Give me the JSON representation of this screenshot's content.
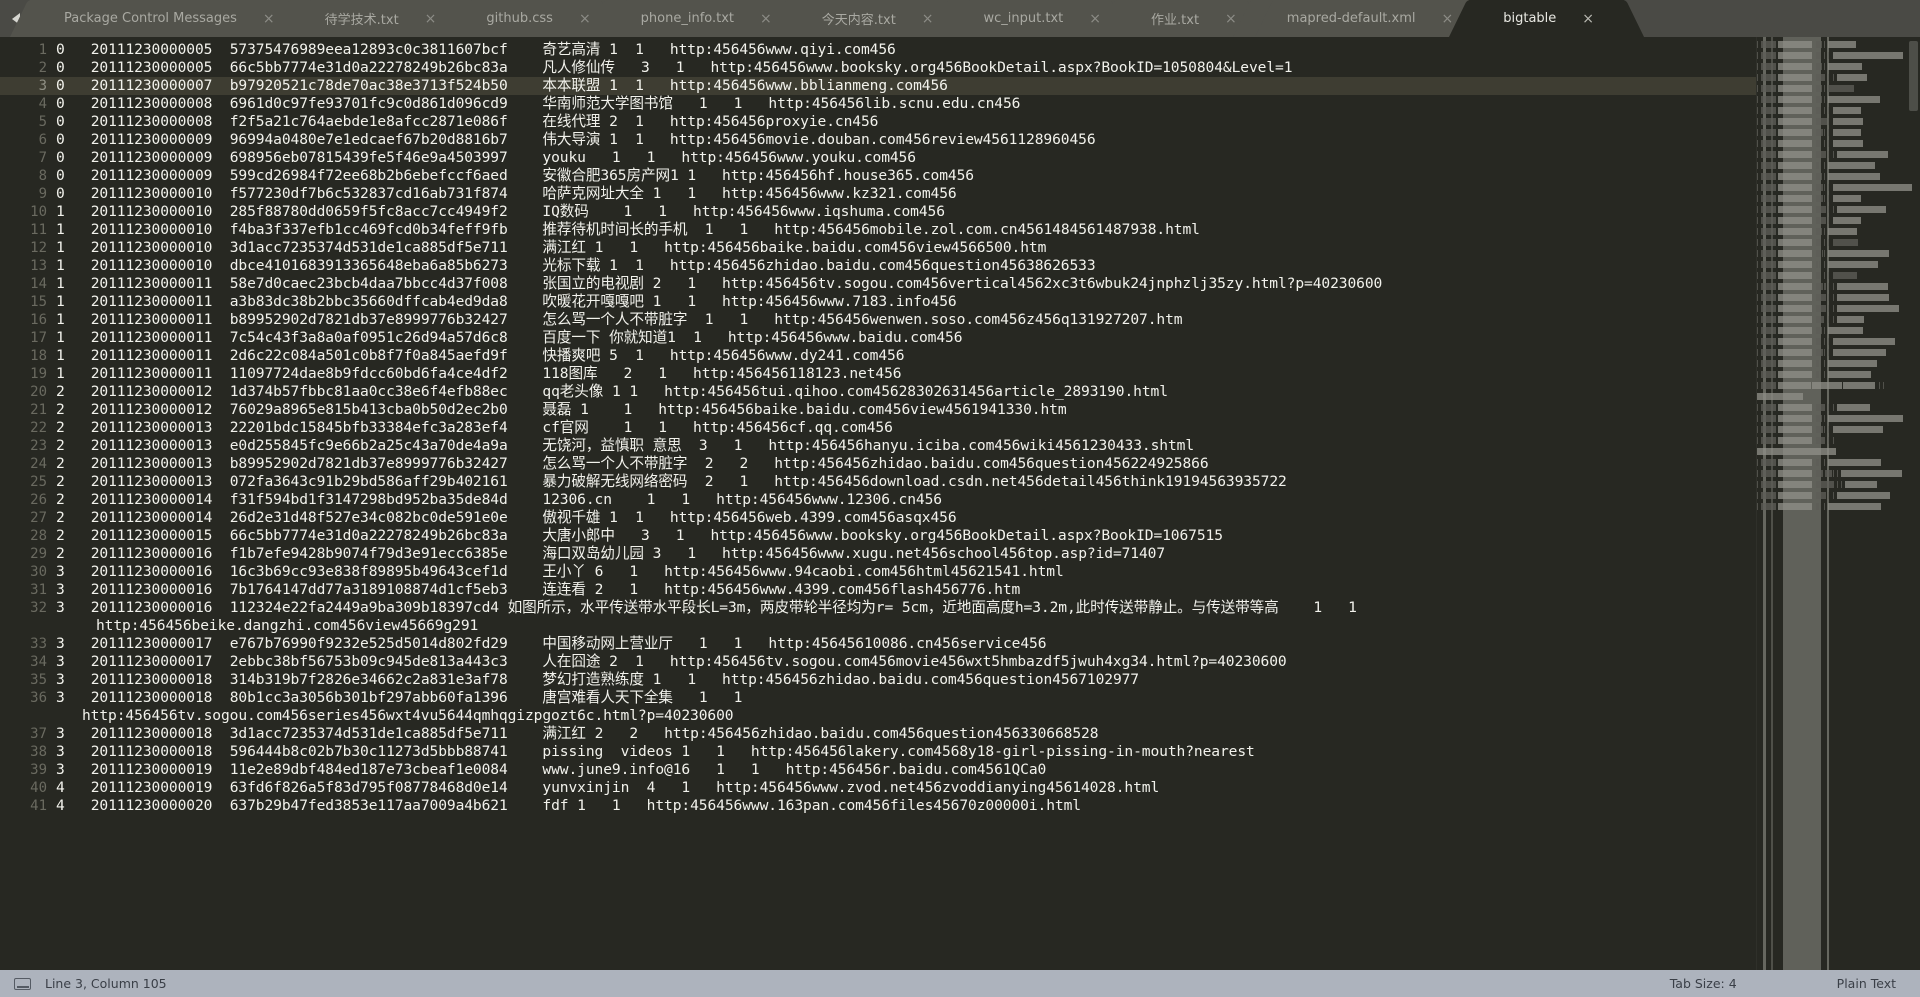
{
  "window": {
    "app": "Sublime Text",
    "nav_prev_icon": "triangle-left-icon",
    "nav_next_icon": "triangle-right-icon",
    "close_glyph": "×"
  },
  "tabs": [
    {
      "label": "Package Control Messages",
      "active": false
    },
    {
      "label": "待学技术.txt",
      "active": false
    },
    {
      "label": "github.css",
      "active": false
    },
    {
      "label": "phone_info.txt",
      "active": false
    },
    {
      "label": "今天内容.txt",
      "active": false
    },
    {
      "label": "wc_input.txt",
      "active": false
    },
    {
      "label": "作业.txt",
      "active": false
    },
    {
      "label": "mapred-default.xml",
      "active": false
    },
    {
      "label": "bigtable",
      "active": true
    }
  ],
  "editor": {
    "active_line_number": 3,
    "lines": [
      {
        "n": "1",
        "text": "0\t20111230000005\t57375476989eea12893c0c3811607bcf\t奇艺高清 1\t1\thttp:456456www.qiyi.com456"
      },
      {
        "n": "2",
        "text": "0\t20111230000005\t66c5bb7774e31d0a22278249b26bc83a\t凡人修仙传\t3\t1\thttp:456456www.booksky.org456BookDetail.aspx?BookID=1050804&Level=1"
      },
      {
        "n": "3",
        "text": "0\t20111230000007\tb97920521c78de70ac38e3713f524b50\t本本联盟 1\t1\thttp:456456www.bblianmeng.com456"
      },
      {
        "n": "4",
        "text": "0\t20111230000008\t6961d0c97fe93701fc9c0d861d096cd9\t华南师范大学图书馆\t1\t1\thttp:456456lib.scnu.edu.cn456"
      },
      {
        "n": "5",
        "text": "0\t20111230000008\tf2f5a21c764aebde1e8afcc2871e086f\t在线代理 2\t1\thttp:456456proxyie.cn456"
      },
      {
        "n": "6",
        "text": "0\t20111230000009\t96994a0480e7e1edcaef67b20d8816b7\t伟大导演 1\t1\thttp:456456movie.douban.com456review4561128960456"
      },
      {
        "n": "7",
        "text": "0\t20111230000009\t698956eb07815439fe5f46e9a4503997\tyouku\t1\t1\thttp:456456www.youku.com456"
      },
      {
        "n": "8",
        "text": "0\t20111230000009\t599cd26984f72ee68b2b6ebefccf6aed\t安徽合肥365房产网1\t1\thttp:456456hf.house365.com456"
      },
      {
        "n": "9",
        "text": "0\t20111230000010\tf577230df7b6c532837cd16ab731f874\t哈萨克网址大全\t1\t1\thttp:456456www.kz321.com456"
      },
      {
        "n": "10",
        "text": "1\t20111230000010\t285f88780dd0659f5fc8acc7cc4949f2\tIQ数码\t1\t1\thttp:456456www.iqshuma.com456"
      },
      {
        "n": "11",
        "text": "1\t20111230000010\tf4ba3f337efb1cc469fcd0b34feff9fb\t推荐待机时间长的手机\t1\t1\thttp:456456mobile.zol.com.cn4561484561487938.html"
      },
      {
        "n": "12",
        "text": "1\t20111230000010\t3d1acc7235374d531de1ca885df5e711\t满江红\t1\t1\thttp:456456baike.baidu.com456view4566500.htm"
      },
      {
        "n": "13",
        "text": "1\t20111230000010\tdbce4101683913365648eba6a85b6273\t光标下载 1\t1\thttp:456456zhidao.baidu.com456question45638626533"
      },
      {
        "n": "14",
        "text": "1\t20111230000011\t58e7d0caec23bcb4daa7bbcc4d37f008\t张国立的电视剧\t2\t1\thttp:456456tv.sogou.com456vertical4562xc3t6wbuk24jnphzlj35zy.html?p=40230600"
      },
      {
        "n": "15",
        "text": "1\t20111230000011\ta3b83dc38b2bbc35660dffcab4ed9da8\t吹暖花开嘎嘎吧\t1\t1\thttp:456456www.7183.info456"
      },
      {
        "n": "16",
        "text": "1\t20111230000011\tb89952902d7821db37e8999776b32427\t怎么骂一个人不带脏字\t1\t1\thttp:456456wenwen.soso.com456z456q131927207.htm"
      },
      {
        "n": "17",
        "text": "1\t20111230000011\t7c54c43f3a8a0af0951c26d94a57d6c8\t百度一下 你就知道1\t1\thttp:456456www.baidu.com456"
      },
      {
        "n": "18",
        "text": "1\t20111230000011\t2d6c22c084a501c0b8f7f0a845aefd9f\t快播爽吧 5\t1\thttp:456456www.dy241.com456"
      },
      {
        "n": "19",
        "text": "1\t20111230000011\t11097724dae8b9fdcc60bd6fa4ce4df2\t118图库\t2\t1\thttp:456456118123.net456"
      },
      {
        "n": "20",
        "text": "2\t20111230000012\t1d374b57fbbc81aa0cc38e6f4efb88ec\tqq老头像 1\t1\thttp:456456tui.qihoo.com45628302631456article_2893190.html"
      },
      {
        "n": "21",
        "text": "2\t20111230000012\t76029a8965e815b413cba0b50d2ec2b0\t聂磊 1\t1\thttp:456456baike.baidu.com456view4561941330.htm"
      },
      {
        "n": "22",
        "text": "2\t20111230000013\t22201bdc15845bfb33384efc3a283ef4\tcf官网\t1\t1\thttp:456456cf.qq.com456"
      },
      {
        "n": "23",
        "text": "2\t20111230000013\te0d255845fc9e66b2a25c43a70de4a9a\t无饶河，益慎职 意思\t3\t1\thttp:456456hanyu.iciba.com456wiki4561230433.shtml"
      },
      {
        "n": "24",
        "text": "2\t20111230000013\tb89952902d7821db37e8999776b32427\t怎么骂一个人不带脏字\t2\t2\thttp:456456zhidao.baidu.com456question456224925866"
      },
      {
        "n": "25",
        "text": "2\t20111230000013\t072fa3643c91b29bd586aff29b402161\t暴力破解无线网络密码\t2\t1\thttp:456456download.csdn.net456detail456think19194563935722"
      },
      {
        "n": "26",
        "text": "2\t20111230000014\tf31f594bd1f3147298bd952ba35de84d\t12306.cn\t1\t1\thttp:456456www.12306.cn456"
      },
      {
        "n": "27",
        "text": "2\t20111230000014\t26d2e31d48f527e34c082bc0de591e0e\t傲视千雄 1\t1\thttp:456456web.4399.com456asqx456"
      },
      {
        "n": "28",
        "text": "2\t20111230000015\t66c5bb7774e31d0a22278249b26bc83a\t大唐小郎中\t3\t1\thttp:456456www.booksky.org456BookDetail.aspx?BookID=1067515"
      },
      {
        "n": "29",
        "text": "2\t20111230000016\tf1b7efe9428b9074f79d3e91ecc6385e\t海口双岛幼儿园\t3\t1\thttp:456456www.xugu.net456school456top.asp?id=71407"
      },
      {
        "n": "30",
        "text": "3\t20111230000016\t16c3b69cc93e838f89895b49643cef1d\t王小丫\t6\t1\thttp:456456www.94caobi.com456html45621541.html"
      },
      {
        "n": "31",
        "text": "3\t20111230000016\t7b1764147dd77a3189108874d1cf5eb3\t连连看\t2\t1\thttp:456456www.4399.com456flash456776.htm"
      },
      {
        "n": "32",
        "text": "3\t20111230000016\t112324e22fa2449a9ba309b18397cd4\t如图所示，水平传送带水平段长L=3m，两皮带轮半径均为r= 5cm，近地面高度h=3.2m,此时传送带静止。与传送带等高\t1\t1"
      },
      {
        "n": "",
        "text": "http:456456beike.dangzhi.com456view45669g291",
        "wrap": true
      },
      {
        "n": "33",
        "text": "3\t20111230000017\te767b76990f9232e525d5014d802fd29\t中国移动网上营业厅\t1\t1\thttp:45645610086.cn456service456"
      },
      {
        "n": "34",
        "text": "3\t20111230000017\t2ebbc38bf56753b09c945de813a443c3\t人在囧途 2\t1\thttp:456456tv.sogou.com456movie456wxt5hmbazdf5jwuh4xg34.html?p=40230600"
      },
      {
        "n": "35",
        "text": "3\t20111230000018\t314b319b7f2826e34662c2a831e3af78\t梦幻打造熟练度\t1\t1\thttp:456456zhidao.baidu.com456question4567102977"
      },
      {
        "n": "36",
        "text": "3\t20111230000018\t80b1cc3a3056b301bf297abb60fa1396\t唐宫难看人天下全集\t1\t1"
      },
      {
        "n": "",
        "text": "http:456456tv.sogou.com456series456wxt4vu5644qmhqgizpgozt6c.html?p=40230600",
        "wrap": true,
        "narrow": true
      },
      {
        "n": "37",
        "text": "3\t20111230000018\t3d1acc7235374d531de1ca885df5e711\t满江红\t2\t2\thttp:456456zhidao.baidu.com456question456330668528"
      },
      {
        "n": "38",
        "text": "3\t20111230000018\t596444b8c02b7b30c11273d5bbb88741\tpissing  videos 1\t1\thttp:456456lakery.com4568y18-girl-pissing-in-mouth?nearest"
      },
      {
        "n": "39",
        "text": "3\t20111230000019\t11e2e89dbf484ed187e73cbeaf1e0084\twww.june9.info@16\t1\t1\thttp:456456r.baidu.com4561QCa0"
      },
      {
        "n": "40",
        "text": "4\t20111230000019\t63fd6f826a5f83d795f08778468d0e14\tyunvxinjin\t4\t1\thttp:456456www.zvod.net456zvoddianying45614028.html"
      },
      {
        "n": "41",
        "text": "4\t20111230000020\t637b29b47fed3853e117aa7009a4b621\tfdf 1\t1\thttp:456456www.163pan.com456files45670z00000i.html"
      }
    ]
  },
  "statusbar": {
    "sidebar_icon": "sidebar-toggle-icon",
    "cursor_position": "Line 3, Column 105",
    "tab_size": "Tab Size: 4",
    "syntax": "Plain Text"
  },
  "colors": {
    "editor_bg": "#272822",
    "tabbar_bg": "#4a4a45",
    "inactive_tab_bg": "#53534c",
    "active_line_bg": "#3e3d32",
    "text_fg": "#f2f2ec",
    "gutter_fg": "#6a6a60",
    "statusbar_bg": "#adb3bd",
    "statusbar_fg": "#3a3f47"
  }
}
